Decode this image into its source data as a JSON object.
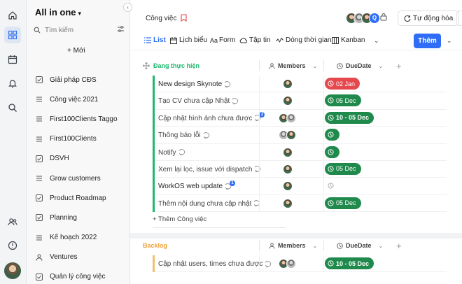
{
  "sidebar": {
    "workspace_label": "All in one",
    "search_placeholder": "Tìm kiếm",
    "new_label": "Mới",
    "items": [
      {
        "label": "Giải pháp CĐS",
        "icon": "checkbox-icon"
      },
      {
        "label": "Công việc 2021",
        "icon": "list-icon"
      },
      {
        "label": "First100Clients Taggo",
        "icon": "list-icon"
      },
      {
        "label": "First100Clients",
        "icon": "list-icon"
      },
      {
        "label": "DSVH",
        "icon": "checkbox-icon"
      },
      {
        "label": "Grow customers",
        "icon": "list-icon"
      },
      {
        "label": "Product Roadmap",
        "icon": "checkbox-icon"
      },
      {
        "label": "Planning",
        "icon": "checkbox-icon"
      },
      {
        "label": "Kế hoạch 2022",
        "icon": "list-icon"
      },
      {
        "label": "Ventures",
        "icon": "user-icon"
      },
      {
        "label": "Quản lý công việc",
        "icon": "checkbox-icon"
      }
    ]
  },
  "header": {
    "title": "Công việc",
    "member_count_badge": "Q",
    "automation_label": "Tự động hóa"
  },
  "views": {
    "tabs": [
      {
        "label": "List",
        "icon": "list-icon"
      },
      {
        "label": "Lịch biểu",
        "icon": "calendar-icon"
      },
      {
        "label": "Form",
        "icon": "font-icon"
      },
      {
        "label": "Tập tin",
        "icon": "cloud-icon"
      },
      {
        "label": "Dòng thời gian",
        "icon": "timeline-icon"
      },
      {
        "label": "Kanban",
        "icon": "kanban-icon"
      }
    ],
    "more_label": "⌄",
    "add_button": "Thêm"
  },
  "columns": {
    "members": "Members",
    "due": "DueDate"
  },
  "groups": [
    {
      "name": "Đang thực hiện",
      "color": "#1fb86c",
      "tasks": [
        {
          "name": "New design Skynote",
          "members": 1,
          "due": "02 Jan",
          "due_color": "red",
          "comment_badge": ""
        },
        {
          "name": "Tạo CV chưa cập Nhật",
          "members": 1,
          "due": "05 Dec",
          "due_color": "green",
          "comment_badge": ""
        },
        {
          "name": "Cập nhật hình ảnh chưa được",
          "members": 2,
          "due": "10 - 05 Dec",
          "due_color": "green",
          "comment_badge": "2"
        },
        {
          "name": "Thông báo lỗi",
          "members": 2,
          "due": "",
          "due_color": "green",
          "comment_badge": ""
        },
        {
          "name": "Notify",
          "members": 1,
          "due": "",
          "due_color": "green",
          "comment_badge": ""
        },
        {
          "name": "Xem lại lọc, issue với dispatch",
          "members": 1,
          "due": "05 Dec",
          "due_color": "green",
          "comment_badge": ""
        },
        {
          "name": "WorkOS web update",
          "members": 1,
          "due": "",
          "due_color": "empty",
          "comment_badge": "1"
        },
        {
          "name": "Thêm nội dung chưa cập nhật",
          "members": 1,
          "due": "05 Dec",
          "due_color": "green",
          "comment_badge": ""
        }
      ],
      "add_label": "+ Thêm Công việc"
    },
    {
      "name": "Backlog",
      "color": "#f0a23c",
      "tasks": [
        {
          "name": "Cập nhật users, times chưa được",
          "members": 2,
          "due": "10 - 05 Dec",
          "due_color": "green",
          "comment_badge": ""
        }
      ]
    }
  ]
}
